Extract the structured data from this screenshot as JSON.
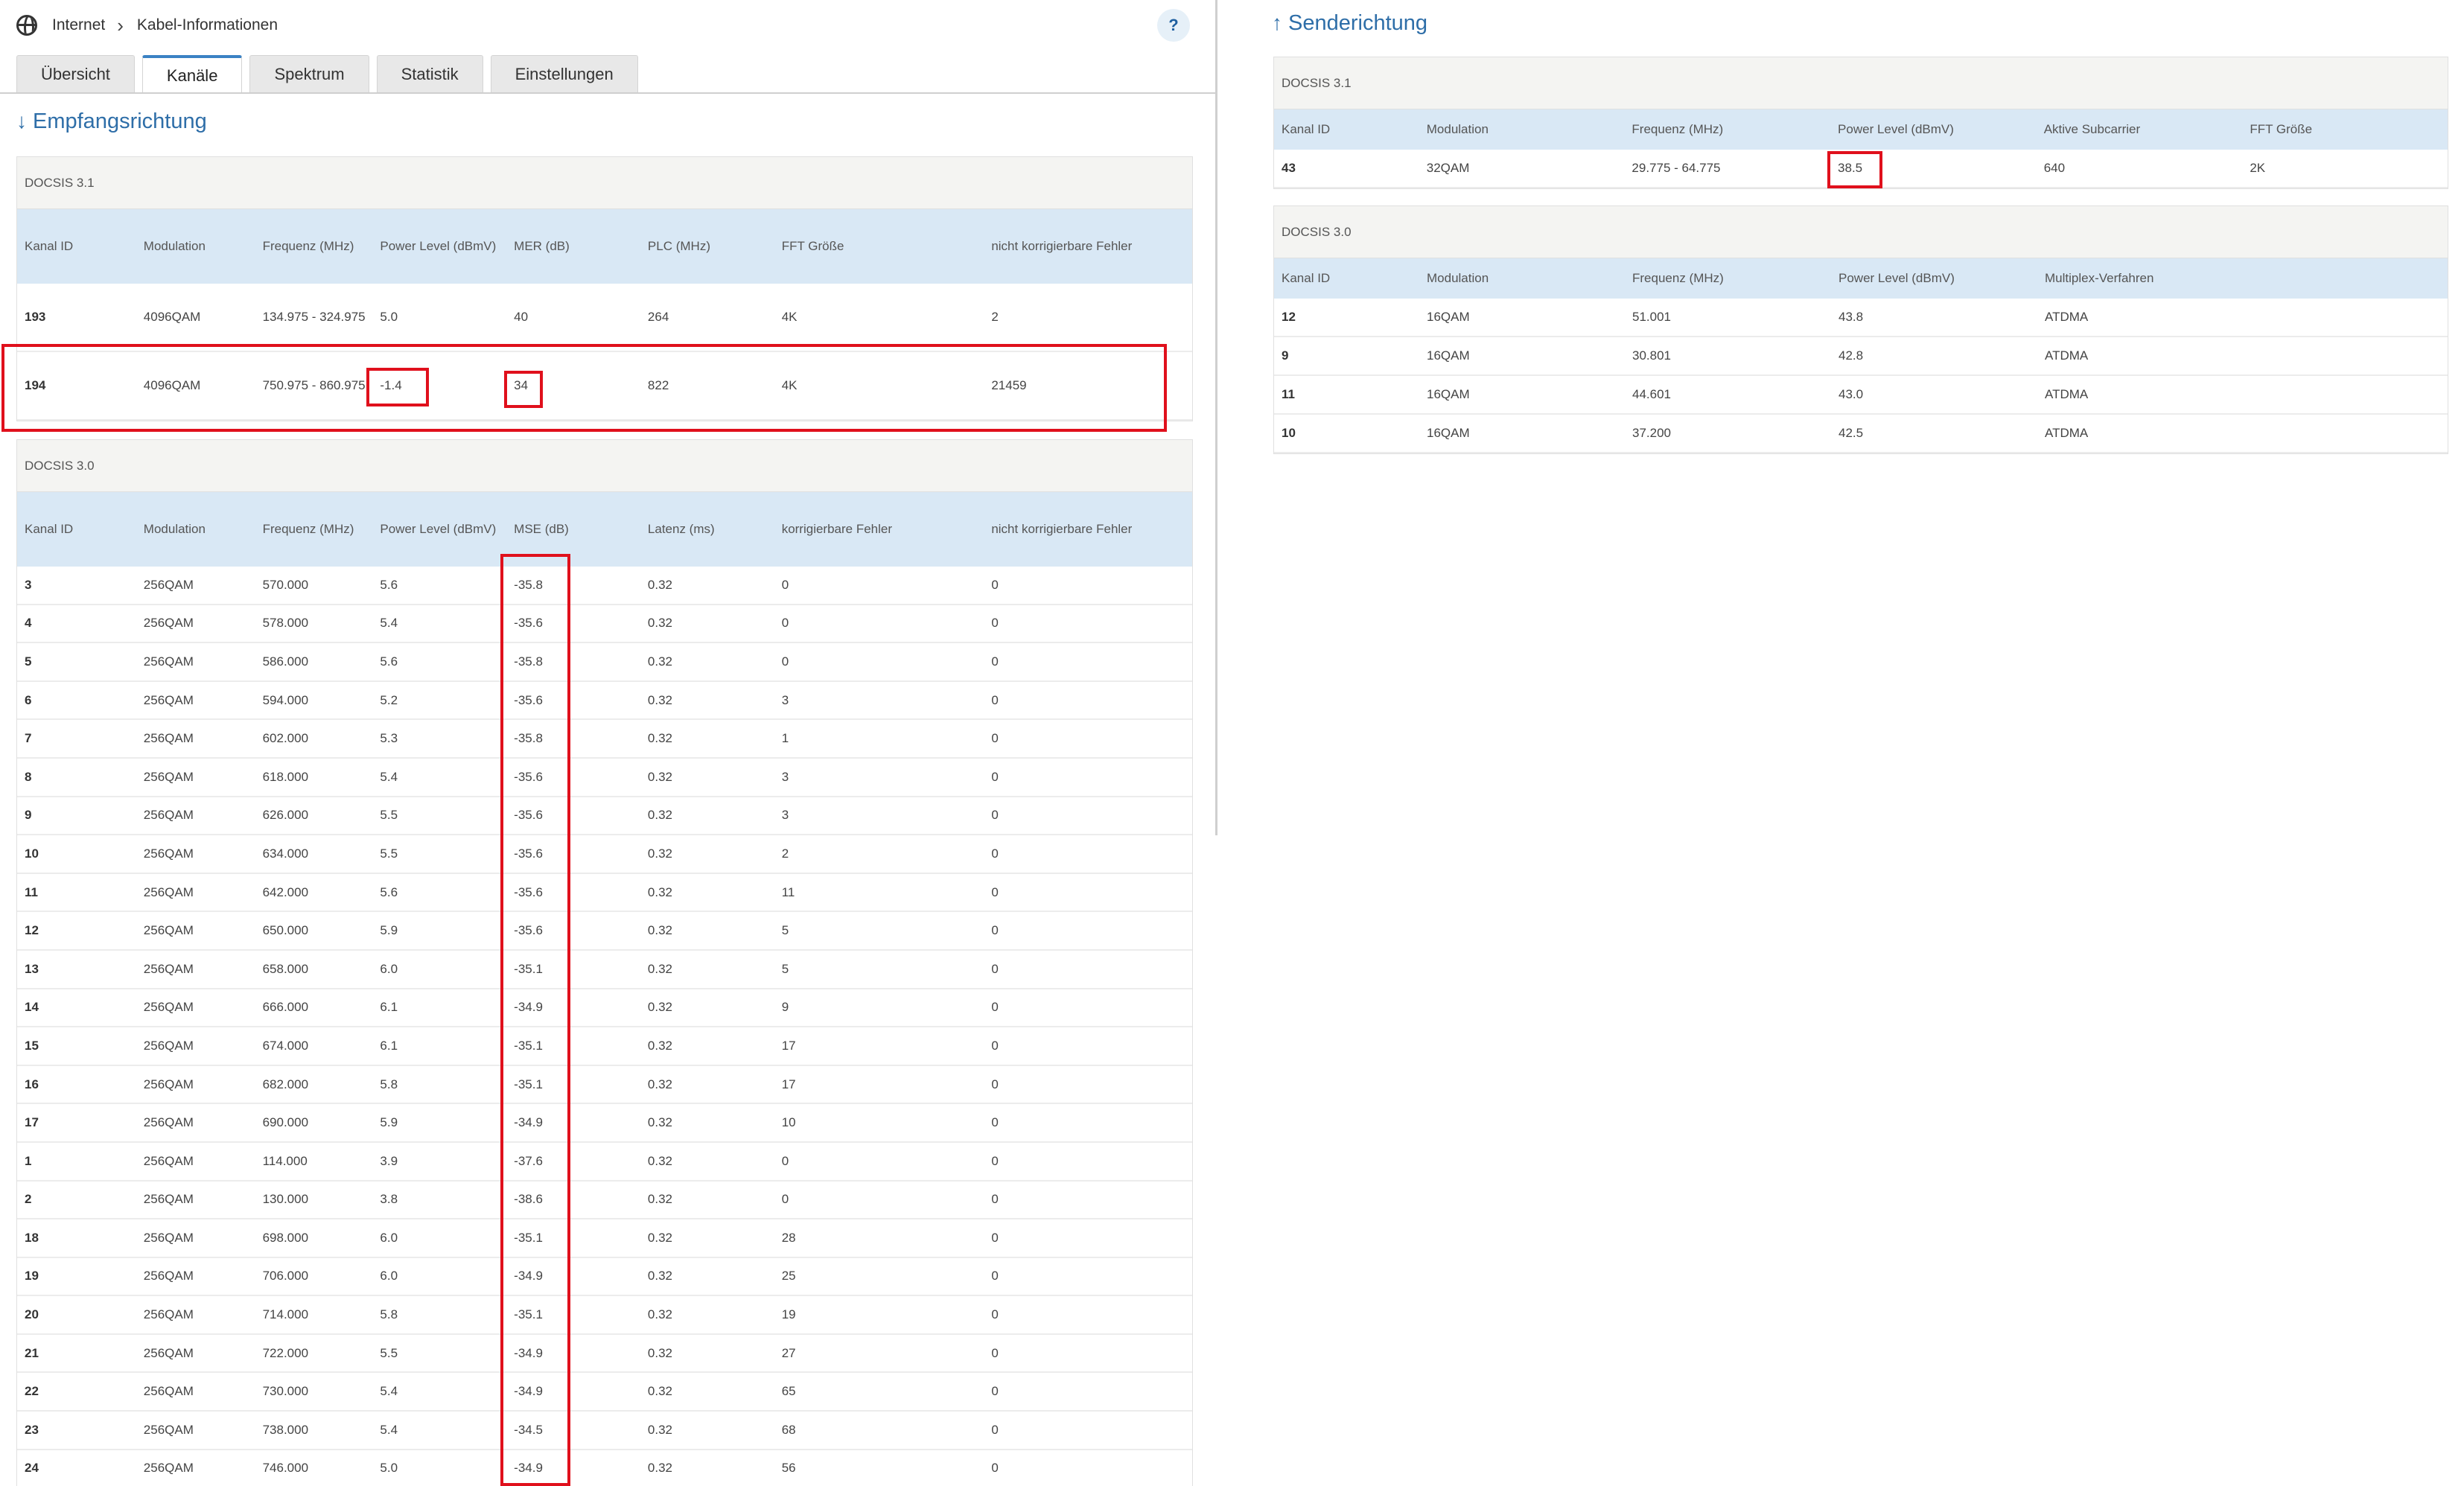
{
  "breadcrumb": {
    "item1": "Internet",
    "item2": "Kabel-Informationen"
  },
  "help_label": "?",
  "tabs": [
    "Übersicht",
    "Kanäle",
    "Spektrum",
    "Statistik",
    "Einstellungen"
  ],
  "downstream": {
    "title": "Empfangsrichtung",
    "docsis31": {
      "label": "DOCSIS 3.1",
      "headers": [
        "Kanal ID",
        "Modulation",
        "Frequenz (MHz)",
        "Power Level (dBmV)",
        "MER (dB)",
        "PLC (MHz)",
        "FFT Größe",
        "nicht korrigierbare Fehler"
      ],
      "rows": [
        [
          "193",
          "4096QAM",
          "134.975 - 324.975",
          "5.0",
          "40",
          "264",
          "4K",
          "2"
        ],
        [
          "194",
          "4096QAM",
          "750.975 - 860.975",
          "-1.4",
          "34",
          "822",
          "4K",
          "21459"
        ]
      ]
    },
    "docsis30": {
      "label": "DOCSIS 3.0",
      "headers": [
        "Kanal ID",
        "Modulation",
        "Frequenz (MHz)",
        "Power Level (dBmV)",
        "MSE (dB)",
        "Latenz (ms)",
        "korrigierbare Fehler",
        "nicht korrigierbare Fehler"
      ],
      "rows": [
        [
          "3",
          "256QAM",
          "570.000",
          "5.6",
          "-35.8",
          "0.32",
          "0",
          "0"
        ],
        [
          "4",
          "256QAM",
          "578.000",
          "5.4",
          "-35.6",
          "0.32",
          "0",
          "0"
        ],
        [
          "5",
          "256QAM",
          "586.000",
          "5.6",
          "-35.8",
          "0.32",
          "0",
          "0"
        ],
        [
          "6",
          "256QAM",
          "594.000",
          "5.2",
          "-35.6",
          "0.32",
          "3",
          "0"
        ],
        [
          "7",
          "256QAM",
          "602.000",
          "5.3",
          "-35.8",
          "0.32",
          "1",
          "0"
        ],
        [
          "8",
          "256QAM",
          "618.000",
          "5.4",
          "-35.6",
          "0.32",
          "3",
          "0"
        ],
        [
          "9",
          "256QAM",
          "626.000",
          "5.5",
          "-35.6",
          "0.32",
          "3",
          "0"
        ],
        [
          "10",
          "256QAM",
          "634.000",
          "5.5",
          "-35.6",
          "0.32",
          "2",
          "0"
        ],
        [
          "11",
          "256QAM",
          "642.000",
          "5.6",
          "-35.6",
          "0.32",
          "11",
          "0"
        ],
        [
          "12",
          "256QAM",
          "650.000",
          "5.9",
          "-35.6",
          "0.32",
          "5",
          "0"
        ],
        [
          "13",
          "256QAM",
          "658.000",
          "6.0",
          "-35.1",
          "0.32",
          "5",
          "0"
        ],
        [
          "14",
          "256QAM",
          "666.000",
          "6.1",
          "-34.9",
          "0.32",
          "9",
          "0"
        ],
        [
          "15",
          "256QAM",
          "674.000",
          "6.1",
          "-35.1",
          "0.32",
          "17",
          "0"
        ],
        [
          "16",
          "256QAM",
          "682.000",
          "5.8",
          "-35.1",
          "0.32",
          "17",
          "0"
        ],
        [
          "17",
          "256QAM",
          "690.000",
          "5.9",
          "-34.9",
          "0.32",
          "10",
          "0"
        ],
        [
          "1",
          "256QAM",
          "114.000",
          "3.9",
          "-37.6",
          "0.32",
          "0",
          "0"
        ],
        [
          "2",
          "256QAM",
          "130.000",
          "3.8",
          "-38.6",
          "0.32",
          "0",
          "0"
        ],
        [
          "18",
          "256QAM",
          "698.000",
          "6.0",
          "-35.1",
          "0.32",
          "28",
          "0"
        ],
        [
          "19",
          "256QAM",
          "706.000",
          "6.0",
          "-34.9",
          "0.32",
          "25",
          "0"
        ],
        [
          "20",
          "256QAM",
          "714.000",
          "5.8",
          "-35.1",
          "0.32",
          "19",
          "0"
        ],
        [
          "21",
          "256QAM",
          "722.000",
          "5.5",
          "-34.9",
          "0.32",
          "27",
          "0"
        ],
        [
          "22",
          "256QAM",
          "730.000",
          "5.4",
          "-34.9",
          "0.32",
          "65",
          "0"
        ],
        [
          "23",
          "256QAM",
          "738.000",
          "5.4",
          "-34.5",
          "0.32",
          "68",
          "0"
        ],
        [
          "24",
          "256QAM",
          "746.000",
          "5.0",
          "-34.9",
          "0.32",
          "56",
          "0"
        ]
      ]
    }
  },
  "upstream": {
    "title": "Senderichtung",
    "docsis31": {
      "label": "DOCSIS 3.1",
      "headers": [
        "Kanal ID",
        "Modulation",
        "Frequenz (MHz)",
        "Power Level (dBmV)",
        "Aktive Subcarrier",
        "FFT Größe"
      ],
      "rows": [
        [
          "43",
          "32QAM",
          "29.775 - 64.775",
          "38.5",
          "640",
          "2K"
        ]
      ]
    },
    "docsis30": {
      "label": "DOCSIS 3.0",
      "headers": [
        "Kanal ID",
        "Modulation",
        "Frequenz (MHz)",
        "Power Level (dBmV)",
        "Multiplex-Verfahren"
      ],
      "rows": [
        [
          "12",
          "16QAM",
          "51.001",
          "43.8",
          "ATDMA"
        ],
        [
          "9",
          "16QAM",
          "30.801",
          "42.8",
          "ATDMA"
        ],
        [
          "11",
          "16QAM",
          "44.601",
          "43.0",
          "ATDMA"
        ],
        [
          "10",
          "16QAM",
          "37.200",
          "42.5",
          "ATDMA"
        ]
      ]
    }
  },
  "colors": {
    "accent": "#2e6ea8",
    "highlight": "#e0101c",
    "header_bg": "#d9e8f5"
  }
}
